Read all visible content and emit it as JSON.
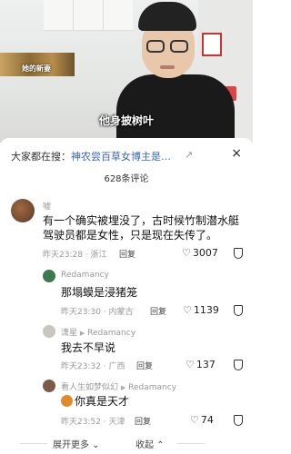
{
  "video": {
    "inset_caption": "她的新妻",
    "inset_small": "",
    "subtitle": "他身披树叶"
  },
  "panel": {
    "search_prefix": "大家都在搜：",
    "search_topic": "神农尝百草女博主是…",
    "search_arrow": "↗",
    "close_icon": "×",
    "comment_count": "628条评论"
  },
  "comments": [
    {
      "username": "嘘",
      "text": "有一个确实被埋没了，古时候竹制潜水艇驾驶员都是女性，只是现在失传了。",
      "time": "昨天23:28 · 浙江",
      "reply": "回复",
      "likes": "3007"
    },
    {
      "username": "Redamancy",
      "text": "那塌蟆是浸猪笼",
      "time": "昨天23:30 · 内蒙古",
      "reply": "回复",
      "likes": "1139"
    },
    {
      "username": "潇星",
      "reply_to": "Redamancy",
      "text": "我去不早说",
      "time": "昨天23:32 · 广西",
      "reply": "回复",
      "likes": "137"
    },
    {
      "username": "看人生如梦似幻",
      "reply_to": "Redamancy",
      "text": "你真是天才",
      "time": "昨天23:52 · 天津",
      "reply": "回复",
      "likes": "74"
    }
  ],
  "footer": {
    "expand": "展开更多 ⌄",
    "collapse": "收起 ⌃"
  }
}
